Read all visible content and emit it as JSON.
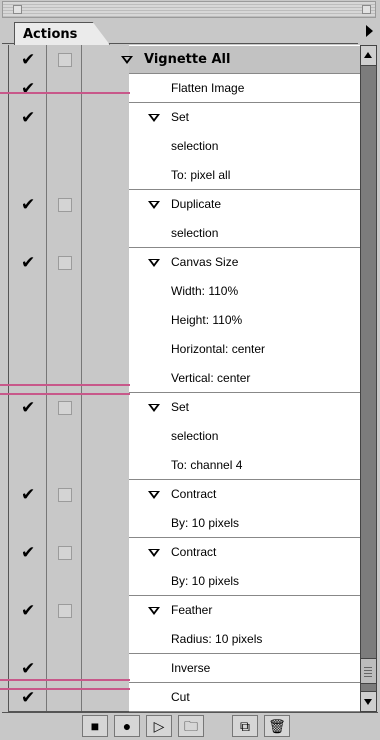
{
  "panel": {
    "tab_label": "Actions",
    "colors": {
      "panel_bg": "#c8c8c8",
      "row_bg": "#ffffff",
      "callout": "#c8588a"
    }
  },
  "actions": [
    {
      "label": "Vignette All",
      "lines": [],
      "checked": true,
      "dialog": true,
      "expandable": true,
      "is_set": true
    },
    {
      "label": "Flatten Image",
      "lines": [],
      "checked": true,
      "dialog": false,
      "expandable": false
    },
    {
      "label": "Set",
      "lines": [
        "selection",
        "To: pixel all"
      ],
      "checked": true,
      "dialog": false,
      "expandable": true
    },
    {
      "label": "Duplicate",
      "lines": [
        "selection"
      ],
      "checked": true,
      "dialog": true,
      "expandable": true
    },
    {
      "label": "Canvas Size",
      "lines": [
        "Width: 110%",
        "Height: 110%",
        "Horizontal: center",
        "Vertical: center"
      ],
      "checked": true,
      "dialog": true,
      "expandable": true
    },
    {
      "label": "Set",
      "lines": [
        "selection",
        "To: channel 4"
      ],
      "checked": true,
      "dialog": true,
      "expandable": true
    },
    {
      "label": "Contract",
      "lines": [
        "By: 10 pixels"
      ],
      "checked": true,
      "dialog": true,
      "expandable": true
    },
    {
      "label": "Contract",
      "lines": [
        "By: 10 pixels"
      ],
      "checked": true,
      "dialog": true,
      "expandable": true
    },
    {
      "label": "Feather",
      "lines": [
        "Radius: 10 pixels"
      ],
      "checked": true,
      "dialog": true,
      "expandable": true
    },
    {
      "label": "Inverse",
      "lines": [],
      "checked": true,
      "dialog": false,
      "expandable": false
    },
    {
      "label": "Cut",
      "lines": [],
      "checked": true,
      "dialog": false,
      "expandable": false
    }
  ],
  "toolbar": {
    "buttons": [
      {
        "name": "stop-button",
        "icon": "stop-icon",
        "glyph": "■"
      },
      {
        "name": "record-button",
        "icon": "record-icon",
        "glyph": "●"
      },
      {
        "name": "play-button",
        "icon": "play-icon",
        "glyph": "▷"
      },
      {
        "name": "new-set-button",
        "icon": "folder-icon",
        "glyph": "🗀"
      },
      {
        "name": "new-action-button",
        "icon": "new-action-icon",
        "glyph": "⧉"
      },
      {
        "name": "delete-button",
        "icon": "trash-icon",
        "glyph": "🗑"
      }
    ]
  }
}
